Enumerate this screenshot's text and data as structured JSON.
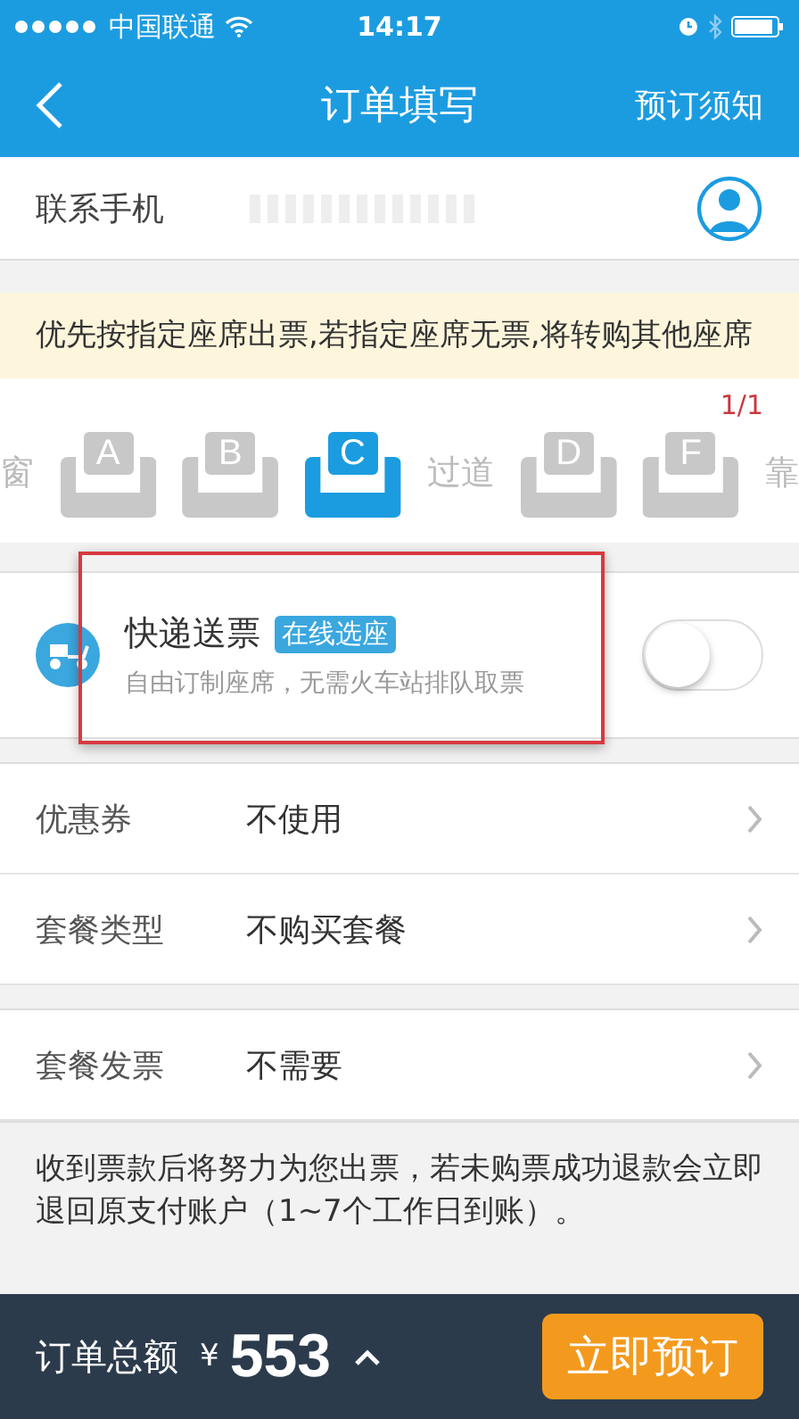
{
  "status_bar": {
    "carrier": "中国联通",
    "time": "14:17"
  },
  "nav": {
    "title": "订单填写",
    "action": "预订须知"
  },
  "contact": {
    "label": "联系手机"
  },
  "notice": "优先按指定座席出票,若指定座席无票,将转购其他座席",
  "seats": {
    "counter": "1/1",
    "items": [
      {
        "kind": "side",
        "label": "窗"
      },
      {
        "kind": "seat",
        "label": "A",
        "selected": false
      },
      {
        "kind": "seat",
        "label": "B",
        "selected": false
      },
      {
        "kind": "seat",
        "label": "C",
        "selected": true
      },
      {
        "kind": "side",
        "label": "过道"
      },
      {
        "kind": "seat",
        "label": "D",
        "selected": false
      },
      {
        "kind": "seat",
        "label": "F",
        "selected": false
      },
      {
        "kind": "side",
        "label": "靠"
      }
    ]
  },
  "delivery": {
    "title": "快递送票",
    "tag": "在线选座",
    "subtitle": "自由订制座席，无需火车站排队取票",
    "on": false,
    "highlighted": true
  },
  "groups": [
    [
      {
        "label": "优惠券",
        "value": "不使用"
      },
      {
        "label": "套餐类型",
        "value": "不购买套餐"
      }
    ],
    [
      {
        "label": "套餐发票",
        "value": "不需要"
      }
    ]
  ],
  "footer_note": "收到票款后将努力为您出票，若未购票成功退款会立即退回原支付账户（1~7个工作日到账）。",
  "bottom_bar": {
    "label": "订单总额",
    "currency": "¥",
    "amount": "553",
    "button": "立即预订"
  }
}
